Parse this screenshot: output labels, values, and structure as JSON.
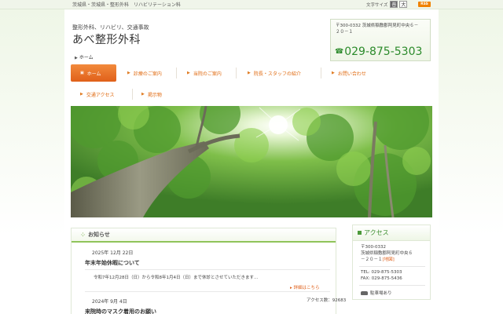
{
  "topbar": {
    "tagline": "茨城県・茨城県・整形外科　リハビリテーション科",
    "font_size_label": "文字サイズ",
    "font_small": "普",
    "font_large": "大",
    "rss": "RSS"
  },
  "header": {
    "subtitle": "整形外科、リハビリ、交通事故",
    "title": "あべ整形外科",
    "address_line1": "〒300-0332 茨城県稲敷郡阿見町中央６－",
    "address_line2": "２０－１",
    "phone": "029-875-5303"
  },
  "breadcrumb": {
    "home": "ホーム"
  },
  "nav": {
    "items": [
      {
        "label": "ホーム"
      },
      {
        "label": "診療のご案内"
      },
      {
        "label": "当院のご案内"
      },
      {
        "label": "院長・スタッフの紹介"
      },
      {
        "label": "お問い合わせ"
      },
      {
        "label": "交通アクセス"
      },
      {
        "label": "掲示物"
      }
    ]
  },
  "news": {
    "heading": "お知らせ",
    "items": [
      {
        "date": "2025年 12月 22日",
        "title": "年末年始休暇について",
        "body": "令和7年12月28日（日）から令和8年1月4日（日）まで休診とさせていただきます...",
        "more": "詳細はこちら"
      },
      {
        "date": "2024年 9月 4日",
        "title": "来院時のマスク着用のお願い"
      }
    ]
  },
  "access": {
    "heading": "アクセス",
    "postal": "〒300-0332",
    "address1": "茨城県稲敷郡阿見町中央６",
    "address2": "－２０－１",
    "map_link": "[地図]",
    "tel": "TEL: 029-875-5303",
    "fax": "FAX: 029-875-5436",
    "parking": "駐車場あり"
  },
  "counter": "アクセス数：92683",
  "colors": {
    "accent": "#e0601a",
    "green": "#3d8f2f",
    "phone": "#2a8a2a"
  }
}
